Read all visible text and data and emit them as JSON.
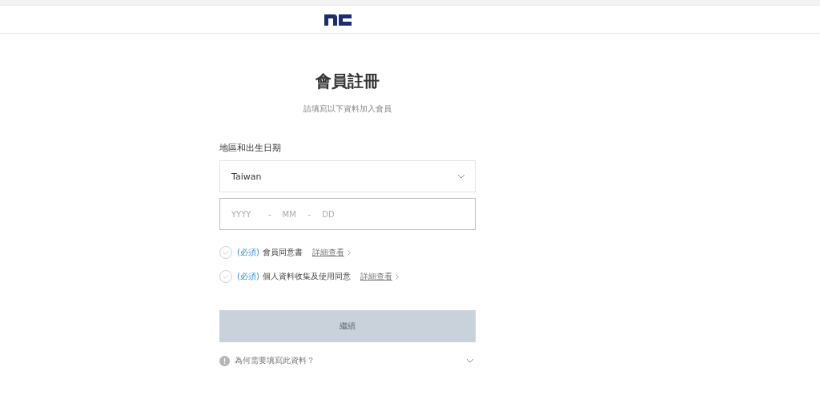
{
  "title": "會員註冊",
  "subtitle": "請填寫以下資料加入會員",
  "section_label": "地區和出生日期",
  "region_select": {
    "value": "Taiwan"
  },
  "birth_date": {
    "parts": [
      {
        "kind": "field",
        "placeholder": "YYYY"
      },
      {
        "kind": "separator",
        "text": "-"
      },
      {
        "kind": "field",
        "placeholder": "MM"
      },
      {
        "kind": "separator",
        "text": "-"
      },
      {
        "kind": "field",
        "placeholder": "DD"
      }
    ]
  },
  "agreements": [
    {
      "required": "(必須)",
      "label": "會員同意書",
      "link": "詳細查看",
      "checked": false
    },
    {
      "required": "(必須)",
      "label": "個人資料收集及使用同意",
      "link": "詳細查看",
      "checked": false
    }
  ],
  "continue_button": {
    "label": "繼續",
    "disabled": true
  },
  "help": {
    "text": "為何需要填寫此資料？",
    "expanded": false
  }
}
